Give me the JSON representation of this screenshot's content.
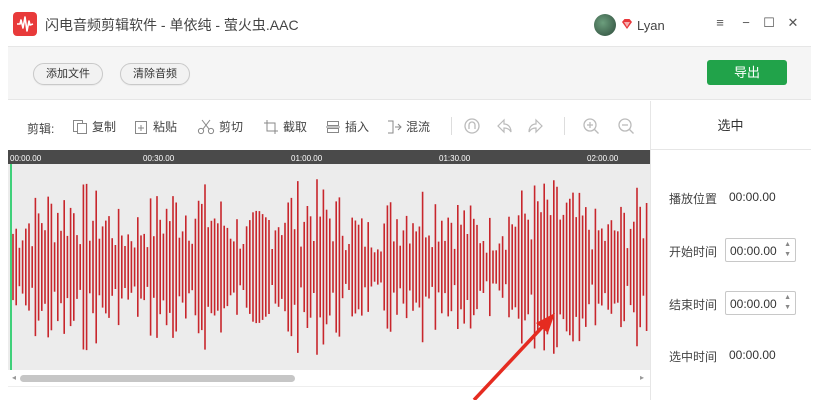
{
  "window": {
    "title": "闪电音频剪辑软件 - 单依纯 - 萤火虫.AAC",
    "username": "Lyan",
    "controls": {
      "menu": "≡",
      "minimize": "−",
      "maximize": "☐",
      "close": "✕"
    }
  },
  "topbar": {
    "add_file": "添加文件",
    "clear_audio": "清除音频",
    "export": "导出",
    "accent_color": "#21a34a"
  },
  "editbar": {
    "label": "剪辑:",
    "tools": [
      {
        "label": "复制",
        "icon": "copy-icon"
      },
      {
        "label": "粘贴",
        "icon": "paste-icon"
      },
      {
        "label": "剪切",
        "icon": "scissors-icon"
      },
      {
        "label": "截取",
        "icon": "crop-icon"
      },
      {
        "label": "插入",
        "icon": "insert-icon"
      },
      {
        "label": "混流",
        "icon": "mix-icon"
      }
    ],
    "icon_only": [
      "loop-icon",
      "undo-icon",
      "redo-icon",
      "zoom-in-icon",
      "zoom-out-icon"
    ]
  },
  "timeline": {
    "labels": [
      "00:00.00",
      "00:30.00",
      "01:00.00",
      "01:30.00",
      "02:00.00"
    ]
  },
  "waveform": {
    "color": "#c8262c"
  },
  "side": {
    "header": "选中",
    "play_position_label": "播放位置",
    "play_position_value": "00:00.00",
    "start_time_label": "开始时间",
    "start_time_value": "00:00.00",
    "end_time_label": "结束时间",
    "end_time_value": "00:00.00",
    "selected_time_label": "选中时间",
    "selected_time_value": "00:00.00"
  },
  "annotation": {
    "color": "#e52b20"
  }
}
